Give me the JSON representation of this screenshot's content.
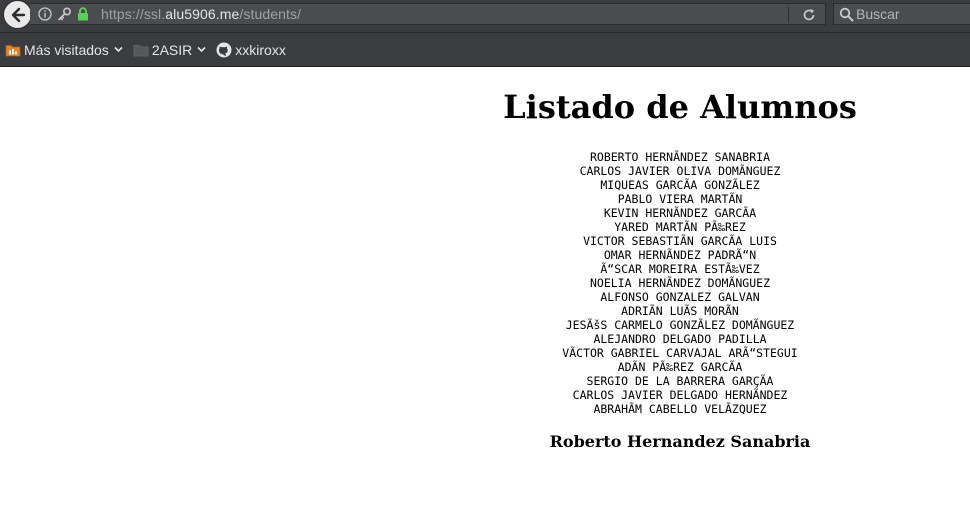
{
  "browser": {
    "url_prefix": "https://ssl.",
    "url_host": "alu5906.me",
    "url_path": "/students/",
    "search_placeholder": "Buscar",
    "bookmarks": [
      {
        "label": "Más visitados",
        "icon": "most-visited-folder-icon"
      },
      {
        "label": "2ASIR",
        "icon": "folder-icon"
      },
      {
        "label": "xxkiroxx",
        "icon": "github-icon"
      }
    ]
  },
  "page": {
    "title": "Listado de Alumnos",
    "students": [
      "ROBERTO HERNÃNDEZ SANABRIA",
      "CARLOS JAVIER OLIVA DOMÃNGUEZ",
      "MIQUEAS GARCÃA GONZÃLEZ",
      "PABLO VIERA MARTÃN",
      "KEVIN HERNÃNDEZ GARCÃA",
      "YARED MARTÃN PÃ‰REZ",
      "VICTOR SEBASTIÃN GARCÃA LUIS",
      "OMAR HERNÃNDEZ PADRÃ“N",
      "Ã“SCAR MOREIRA ESTÃ‰VEZ",
      "NOELIA HERNÃNDEZ DOMÃNGUEZ",
      "ALFONSO GONZALEZ GALVAN",
      "ADRIÃN LUÃS MORÃN",
      "JESÃšS CARMELO GONZÃLEZ DOMÃNGUEZ",
      "ALEJANDRO DELGADO PADILLA",
      "VÃCTOR GABRIEL CARVAJAL ARÃ“STEGUI",
      "ADÃN PÃ‰REZ GARCÃA",
      "SERGIO DE LA BARRERA GARÇÃA",
      "CARLOS JAVIER DELGADO HERNÃNDEZ",
      "ABRAHÃM CABELLO VELÃZQUEZ"
    ],
    "author": "Roberto Hernandez Sanabria"
  },
  "colors": {
    "chrome_bg": "#3a3c3f",
    "field_bg": "#4a4c4f",
    "lock_green": "#5ad15a",
    "page_bg": "#ffffff"
  }
}
